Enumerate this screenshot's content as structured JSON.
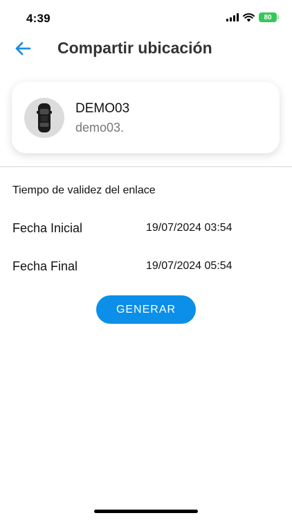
{
  "status_bar": {
    "time": "4:39",
    "battery": "80",
    "icons": [
      "cellular-signal-icon",
      "wifi-icon",
      "battery-icon"
    ]
  },
  "header": {
    "back_icon": "arrow-left-icon",
    "title": "Compartir ubicación"
  },
  "vehicle": {
    "name": "DEMO03",
    "subtitle": "demo03.",
    "icon": "car-top-view-icon"
  },
  "validity": {
    "section_title": "Tiempo de validez del enlace",
    "start_label": "Fecha Inicial",
    "start_value": "19/07/2024 03:54",
    "end_label": "Fecha Final",
    "end_value": "19/07/2024 05:54"
  },
  "actions": {
    "generate_label": "GENERAR"
  },
  "colors": {
    "accent": "#0b8fe8",
    "battery": "#35c759",
    "title": "#333333",
    "subtitle": "#777777"
  }
}
